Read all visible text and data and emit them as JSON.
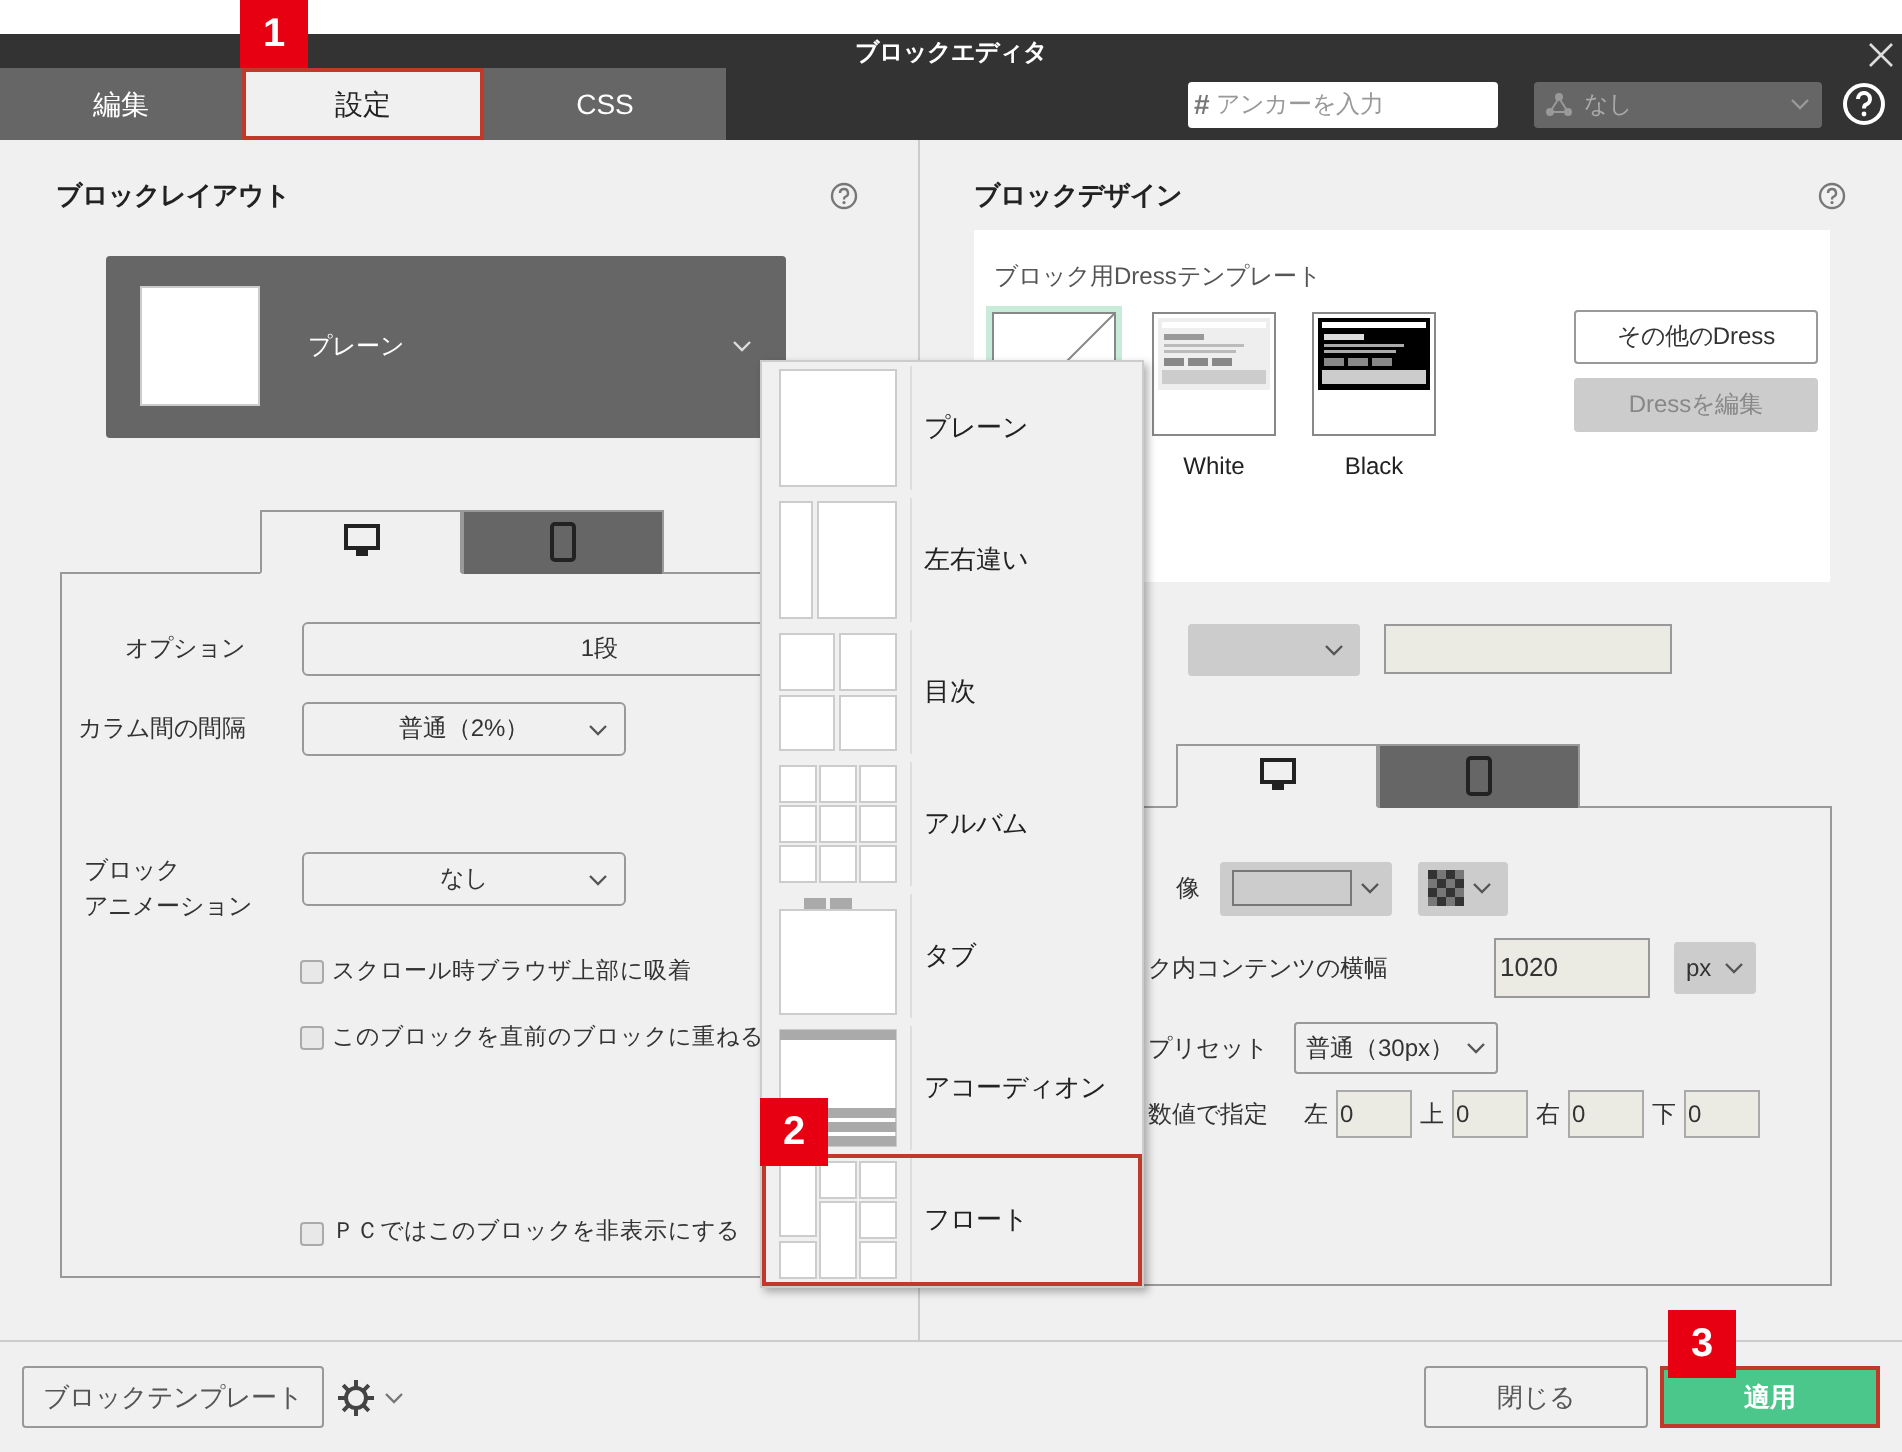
{
  "window": {
    "title": "ブロックエディタ"
  },
  "annotations": [
    {
      "label": "1"
    },
    {
      "label": "2"
    },
    {
      "label": "3"
    }
  ],
  "tabs": [
    {
      "label": "編集",
      "selected": false
    },
    {
      "label": "設定",
      "selected": true
    },
    {
      "label": "CSS",
      "selected": false
    }
  ],
  "anchor_field": {
    "prefix": "#",
    "placeholder": "アンカーを入力"
  },
  "anchor_select": {
    "value": "なし",
    "disabled": true
  },
  "layout_panel": {
    "title": "ブロックレイアウト",
    "layout_select": {
      "value": "プレーン"
    },
    "device_tabs": [
      {
        "kind": "desktop",
        "selected": true
      },
      {
        "kind": "mobile",
        "selected": false
      }
    ],
    "option": {
      "label": "オプション",
      "value": "1段"
    },
    "column_gap": {
      "label": "カラム間の間隔",
      "value": "普通（2%）"
    },
    "animation": {
      "label_lines": [
        "ブロック",
        "アニメーション"
      ],
      "value": "なし"
    },
    "checkboxes": [
      {
        "label": "スクロール時ブラウザ上部に吸着",
        "checked": false
      },
      {
        "label": "このブロックを直前のブロックに重ねる",
        "checked": false
      },
      {
        "label": "ＰＣではこのブロックを非表示にする",
        "checked": false
      }
    ]
  },
  "layout_menu": {
    "items": [
      {
        "label": "プレーン",
        "kind": "plain",
        "selected": false
      },
      {
        "label": "左右違い",
        "kind": "split",
        "selected": false
      },
      {
        "label": "目次",
        "kind": "index",
        "selected": false
      },
      {
        "label": "アルバム",
        "kind": "album",
        "selected": false
      },
      {
        "label": "タブ",
        "kind": "tab",
        "selected": false
      },
      {
        "label": "アコーディオン",
        "kind": "accordion",
        "selected": false
      },
      {
        "label": "フロート",
        "kind": "float",
        "selected": true
      }
    ]
  },
  "design_panel": {
    "title": "ブロックデザイン",
    "dress": {
      "title": "ブロック用Dressテンプレート",
      "templates": [
        {
          "kind": "plain",
          "selected": true
        },
        {
          "kind": "white",
          "label": "White",
          "selected": false
        },
        {
          "kind": "black",
          "label": "Black",
          "selected": false
        }
      ],
      "buttons": [
        {
          "label": "その他のDress",
          "disabled": false
        },
        {
          "label": "Dressを編集",
          "disabled": true
        }
      ]
    },
    "device_tabs": [
      {
        "kind": "desktop",
        "selected": true
      },
      {
        "kind": "mobile",
        "selected": false
      }
    ],
    "background_image": {
      "label": "像"
    },
    "content_width": {
      "label": "ク内コンテンツの横幅",
      "value": "1020",
      "unit": "px"
    },
    "padding_preset": {
      "label": "プリセット",
      "value": "普通（30px）"
    },
    "padding_values": {
      "label": "数値で指定",
      "fields": [
        {
          "label": "左",
          "value": "0"
        },
        {
          "label": "上",
          "value": "0"
        },
        {
          "label": "右",
          "value": "0"
        },
        {
          "label": "下",
          "value": "0"
        }
      ]
    }
  },
  "footer": {
    "template_button": "ブロックテンプレート",
    "close_button": "閉じる",
    "apply_button": "適用"
  }
}
